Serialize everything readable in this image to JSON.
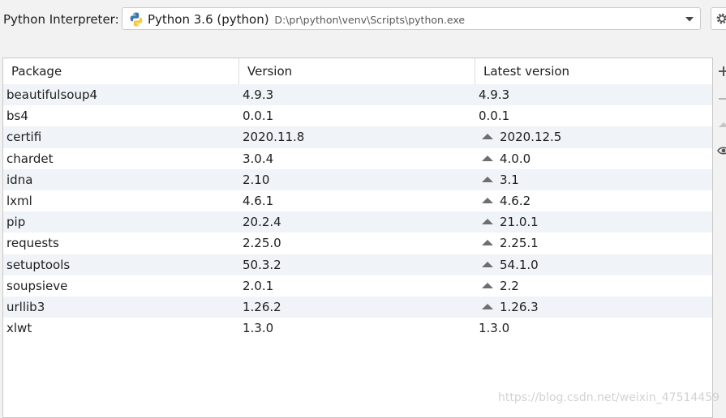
{
  "interpreter": {
    "label": "Python Interpreter:",
    "name": "Python 3.6 (python)",
    "path": "D:\\pr\\python\\venv\\Scripts\\python.exe",
    "icon": "python-icon"
  },
  "table": {
    "columns": [
      "Package",
      "Version",
      "Latest version"
    ],
    "rows": [
      {
        "package": "beautifulsoup4",
        "version": "4.9.3",
        "latest": "4.9.3",
        "upgrade": false
      },
      {
        "package": "bs4",
        "version": "0.0.1",
        "latest": "0.0.1",
        "upgrade": false
      },
      {
        "package": "certifi",
        "version": "2020.11.8",
        "latest": "2020.12.5",
        "upgrade": true
      },
      {
        "package": "chardet",
        "version": "3.0.4",
        "latest": "4.0.0",
        "upgrade": true
      },
      {
        "package": "idna",
        "version": "2.10",
        "latest": "3.1",
        "upgrade": true
      },
      {
        "package": "lxml",
        "version": "4.6.1",
        "latest": "4.6.2",
        "upgrade": true
      },
      {
        "package": "pip",
        "version": "20.2.4",
        "latest": "21.0.1",
        "upgrade": true
      },
      {
        "package": "requests",
        "version": "2.25.0",
        "latest": "2.25.1",
        "upgrade": true
      },
      {
        "package": "setuptools",
        "version": "50.3.2",
        "latest": "54.1.0",
        "upgrade": true
      },
      {
        "package": "soupsieve",
        "version": "2.0.1",
        "latest": "2.2",
        "upgrade": true
      },
      {
        "package": "urllib3",
        "version": "1.26.2",
        "latest": "1.26.3",
        "upgrade": true
      },
      {
        "package": "xlwt",
        "version": "1.3.0",
        "latest": "1.3.0",
        "upgrade": false
      }
    ]
  },
  "toolbar": {
    "icons": [
      "add-icon",
      "remove-icon",
      "upgrade-icon",
      "eye-icon"
    ]
  },
  "watermark": "https://blog.csdn.net/weixin_47514459",
  "colors": {
    "background": "#f2f2f2",
    "alt_row": "#f0f3f8",
    "upgrade_arrow": "#6e6e6e"
  }
}
